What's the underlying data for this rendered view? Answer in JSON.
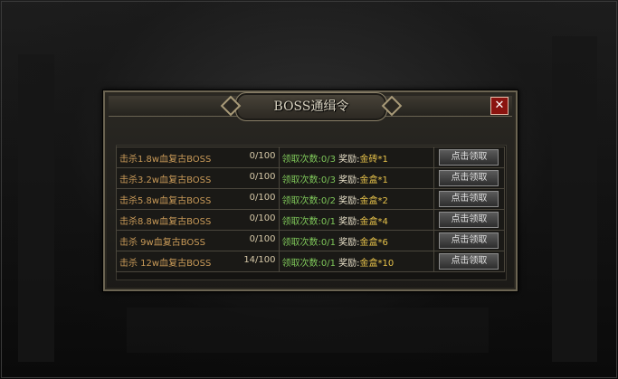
{
  "dialog": {
    "title": "BOSS通缉令",
    "close_symbol": "✕"
  },
  "quests": [
    {
      "kill": "击杀1.8w血复古BOSS",
      "progress": "0/100",
      "claims_label": "领取次数:",
      "claims": "0/3",
      "reward_label": "奖励:",
      "reward": "金砖*1",
      "button": "点击领取"
    },
    {
      "kill": "击杀3.2w血复古BOSS",
      "progress": "0/100",
      "claims_label": "领取次数:",
      "claims": "0/3",
      "reward_label": "奖励:",
      "reward": "金盒*1",
      "button": "点击领取"
    },
    {
      "kill": "击杀5.8w血复古BOSS",
      "progress": "0/100",
      "claims_label": "领取次数:",
      "claims": "0/2",
      "reward_label": "奖励:",
      "reward": "金盒*2",
      "button": "点击领取"
    },
    {
      "kill": "击杀8.8w血复古BOSS",
      "progress": "0/100",
      "claims_label": "领取次数:",
      "claims": "0/1",
      "reward_label": "奖励:",
      "reward": "金盒*4",
      "button": "点击领取"
    },
    {
      "kill": "击杀 9w血复古BOSS",
      "progress": "0/100",
      "claims_label": "领取次数:",
      "claims": "0/1",
      "reward_label": "奖励:",
      "reward": "金盒*6",
      "button": "点击领取"
    },
    {
      "kill": "击杀 12w血复古BOSS",
      "progress": "14/100",
      "claims_label": "领取次数:",
      "claims": "0/1",
      "reward_label": "奖励:",
      "reward": "金盒*10",
      "button": "点击领取"
    }
  ],
  "colors": {
    "kill_text": "#c99a58",
    "claims_text": "#7fc85a",
    "reward_text": "#e7c24a",
    "close_button": "#8a1410"
  }
}
